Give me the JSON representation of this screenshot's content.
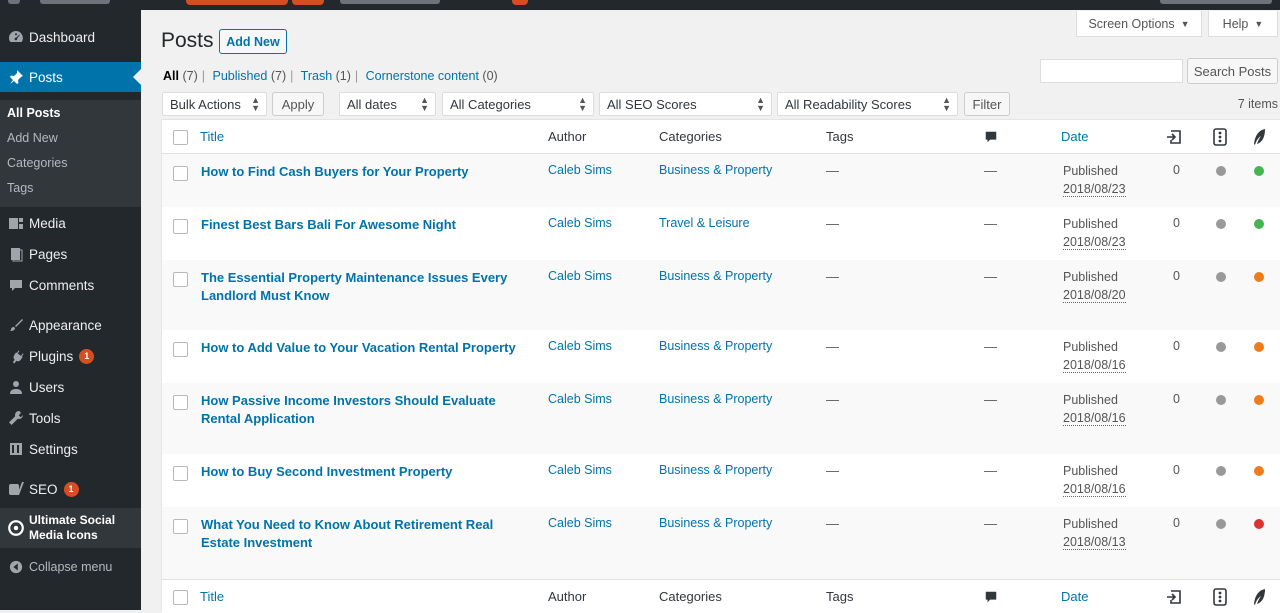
{
  "sidebar": {
    "items": [
      {
        "id": "dashboard",
        "label": "Dashboard",
        "icon": "dashboard-icon"
      },
      {
        "id": "posts",
        "label": "Posts",
        "icon": "pushpin-icon"
      },
      {
        "id": "media",
        "label": "Media",
        "icon": "media-icon"
      },
      {
        "id": "pages",
        "label": "Pages",
        "icon": "pages-icon"
      },
      {
        "id": "comments",
        "label": "Comments",
        "icon": "comment-icon"
      },
      {
        "id": "appearance",
        "label": "Appearance",
        "icon": "paintbrush-icon"
      },
      {
        "id": "plugins",
        "label": "Plugins",
        "icon": "plug-icon",
        "count": "1"
      },
      {
        "id": "users",
        "label": "Users",
        "icon": "user-icon"
      },
      {
        "id": "tools",
        "label": "Tools",
        "icon": "wrench-icon"
      },
      {
        "id": "settings",
        "label": "Settings",
        "icon": "sliders-icon"
      },
      {
        "id": "seo",
        "label": "SEO",
        "icon": "yoast-icon",
        "count": "1"
      },
      {
        "id": "usm",
        "label": "Ultimate Social Media Icons",
        "icon": "social-icons-icon"
      },
      {
        "id": "collapse",
        "label": "Collapse menu",
        "icon": "collapse-icon"
      }
    ],
    "submenu": [
      "All Posts",
      "Add New",
      "Categories",
      "Tags"
    ]
  },
  "header": {
    "title": "Posts",
    "add_new": "Add New",
    "screen_options": "Screen Options",
    "help": "Help"
  },
  "views": [
    {
      "label": "All",
      "count": "(7)"
    },
    {
      "label": "Published",
      "count": "(7)"
    },
    {
      "label": "Trash",
      "count": "(1)"
    },
    {
      "label": "Cornerstone content",
      "count": "(0)"
    }
  ],
  "search": {
    "button": "Search Posts",
    "value": ""
  },
  "filters": {
    "bulk_actions": "Bulk Actions",
    "apply": "Apply",
    "dates": "All dates",
    "categories": "All Categories",
    "seo": "All SEO Scores",
    "readability": "All Readability Scores",
    "filter": "Filter",
    "items": "7 items"
  },
  "columns": {
    "title": "Title",
    "author": "Author",
    "categories": "Categories",
    "tags": "Tags",
    "date": "Date"
  },
  "rows": [
    {
      "title_lines": [
        "How to Find Cash Buyers for Your Property",
        ""
      ],
      "author": "Caleb Sims",
      "categories": "Business & Property",
      "tags": "—",
      "comments": "—",
      "status": "Published",
      "date": "2018/08/23",
      "links": "0",
      "seo": "#999999",
      "readability": "#46b450"
    },
    {
      "title_lines": [
        "Finest Best Bars Bali For Awesome Night",
        ""
      ],
      "author": "Caleb Sims",
      "categories": "Travel & Leisure",
      "tags": "—",
      "comments": "—",
      "status": "Published",
      "date": "2018/08/23",
      "links": "0",
      "seo": "#999999",
      "readability": "#46b450"
    },
    {
      "title_lines": [
        "The Essential Property Maintenance Issues Every",
        "Landlord Must Know"
      ],
      "author": "Caleb Sims",
      "categories": "Business & Property",
      "tags": "—",
      "comments": "—",
      "status": "Published",
      "date": "2018/08/20",
      "links": "0",
      "seo": "#999999",
      "readability": "#ee7c1b"
    },
    {
      "title_lines": [
        "How to Add Value to Your Vacation Rental Property",
        ""
      ],
      "author": "Caleb Sims",
      "categories": "Business & Property",
      "tags": "—",
      "comments": "—",
      "status": "Published",
      "date": "2018/08/16",
      "links": "0",
      "seo": "#999999",
      "readability": "#ee7c1b"
    },
    {
      "title_lines": [
        "How Passive Income Investors Should Evaluate",
        "Rental Application"
      ],
      "author": "Caleb Sims",
      "categories": "Business & Property",
      "tags": "—",
      "comments": "—",
      "status": "Published",
      "date": "2018/08/16",
      "links": "0",
      "seo": "#999999",
      "readability": "#ee7c1b"
    },
    {
      "title_lines": [
        "How to Buy Second Investment Property",
        ""
      ],
      "author": "Caleb Sims",
      "categories": "Business & Property",
      "tags": "—",
      "comments": "—",
      "status": "Published",
      "date": "2018/08/16",
      "links": "0",
      "seo": "#999999",
      "readability": "#ee7c1b"
    },
    {
      "title_lines": [
        "What You Need to Know About Retirement Real",
        "Estate Investment"
      ],
      "author": "Caleb Sims",
      "categories": "Business & Property",
      "tags": "—",
      "comments": "—",
      "status": "Published",
      "date": "2018/08/13",
      "links": "0",
      "seo": "#999999",
      "readability": "#dc3232"
    }
  ],
  "colors": {
    "accent": "#0073aa",
    "sidebar": "#23282d",
    "badge": "#d54e21"
  }
}
